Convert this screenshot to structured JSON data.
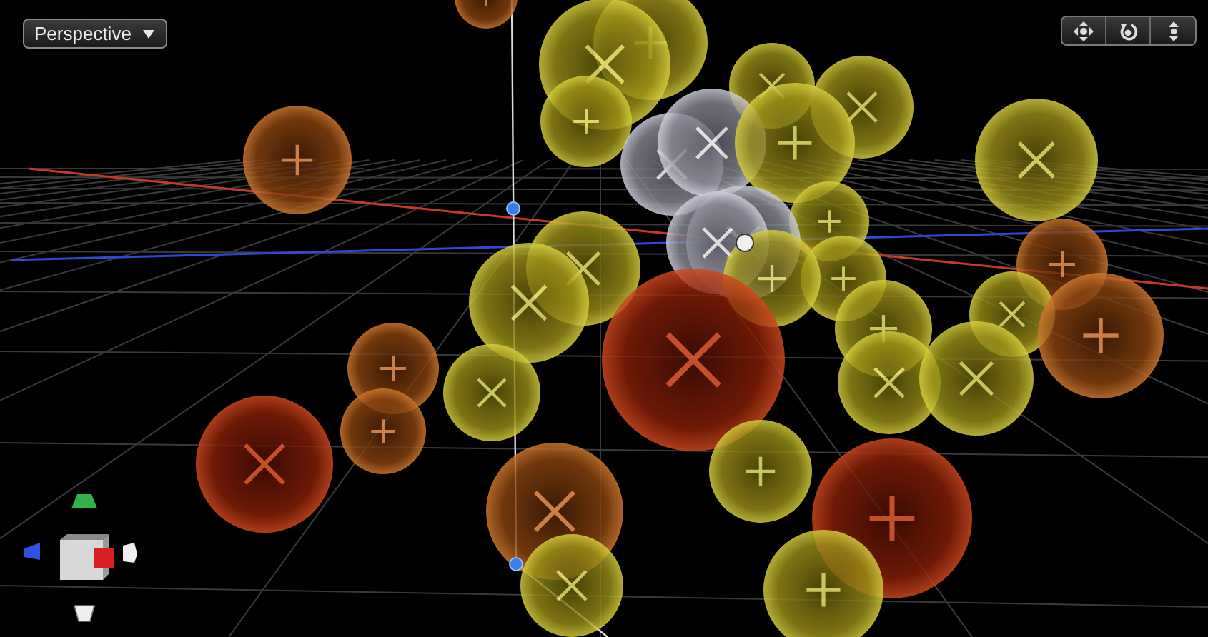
{
  "view_menu": {
    "label": "Perspective"
  }
}
